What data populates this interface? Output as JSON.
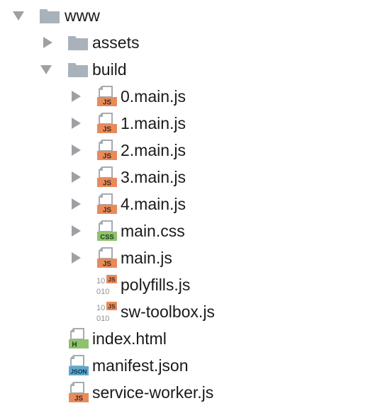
{
  "tree": {
    "root": {
      "label": "www",
      "expanded": true,
      "icon": "folder-icon"
    },
    "assets": {
      "label": "assets",
      "expanded": false,
      "icon": "folder-icon"
    },
    "build": {
      "label": "build",
      "expanded": true,
      "icon": "folder-icon",
      "files": [
        {
          "label": "0.main.js",
          "icon": "js-file-icon",
          "badge": "JS",
          "expandable": true
        },
        {
          "label": "1.main.js",
          "icon": "js-file-icon",
          "badge": "JS",
          "expandable": true
        },
        {
          "label": "2.main.js",
          "icon": "js-file-icon",
          "badge": "JS",
          "expandable": true
        },
        {
          "label": "3.main.js",
          "icon": "js-file-icon",
          "badge": "JS",
          "expandable": true
        },
        {
          "label": "4.main.js",
          "icon": "js-file-icon",
          "badge": "JS",
          "expandable": true
        },
        {
          "label": "main.css",
          "icon": "css-file-icon",
          "badge": "CSS",
          "expandable": true
        },
        {
          "label": "main.js",
          "icon": "js-file-icon",
          "badge": "JS",
          "expandable": true
        },
        {
          "label": "polyfills.js",
          "icon": "minified-js-file-icon",
          "badge": "JS",
          "expandable": false
        },
        {
          "label": "sw-toolbox.js",
          "icon": "minified-js-file-icon",
          "badge": "JS",
          "expandable": false
        }
      ]
    },
    "root_files": [
      {
        "label": "index.html",
        "icon": "html-file-icon",
        "badge": "H"
      },
      {
        "label": "manifest.json",
        "icon": "json-file-icon",
        "badge": "JSON"
      },
      {
        "label": "service-worker.js",
        "icon": "js-file-icon",
        "badge": "JS"
      }
    ]
  },
  "colors": {
    "chevron": "#9da1a5",
    "folder": "#a9b2ba",
    "page": "#a6abb0",
    "js_badge": "#e98a5a",
    "css_badge": "#8ec26e",
    "html_badge": "#8ec26e",
    "json_badge": "#5ea8d0",
    "text": "#1a1a1a"
  }
}
